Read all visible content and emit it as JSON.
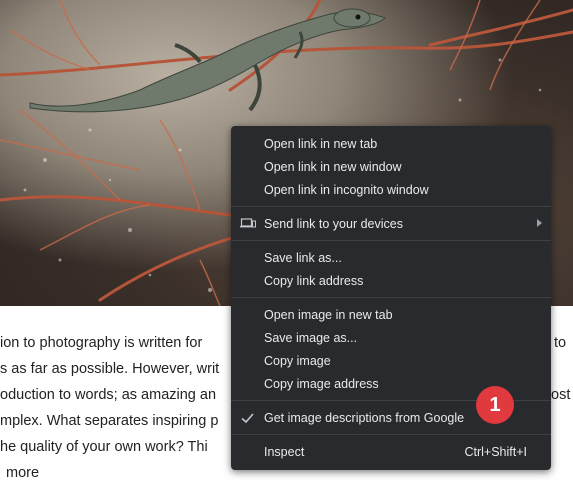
{
  "article": {
    "lines": [
      "ion to photography is written for",
      "s as far as possible. However, writ",
      "oduction to words; as amazing an",
      "mplex. What separates inspiring p",
      "he quality of your own work? Thi",
      "more"
    ],
    "right_fragments": [
      "to",
      "ost"
    ]
  },
  "menu": {
    "items": [
      {
        "label": "Open link in new tab"
      },
      {
        "label": "Open link in new window"
      },
      {
        "label": "Open link in incognito window"
      },
      {
        "label": "Send link to your devices",
        "icon": "devices-icon",
        "submenu": true
      },
      {
        "label": "Save link as..."
      },
      {
        "label": "Copy link address"
      },
      {
        "label": "Open image in new tab"
      },
      {
        "label": "Save image as..."
      },
      {
        "label": "Copy image"
      },
      {
        "label": "Copy image address"
      },
      {
        "label": "Get image descriptions from Google",
        "checked": true
      },
      {
        "label": "Inspect",
        "shortcut": "Ctrl+Shift+I"
      }
    ]
  },
  "badge": {
    "text": "1",
    "color": "#e0393e"
  },
  "colors": {
    "menu_bg": "#292a2d",
    "menu_text": "#e8eaed"
  }
}
